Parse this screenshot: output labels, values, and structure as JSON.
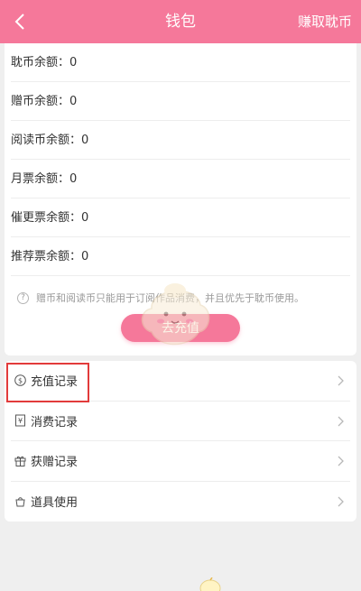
{
  "header": {
    "back_icon": "chevron-left-icon",
    "title": "钱包",
    "action": "赚取耽币"
  },
  "balances": [
    {
      "label": "耽币余额：",
      "value": "0"
    },
    {
      "label": "赠币余额：",
      "value": "0"
    },
    {
      "label": "阅读币余额：",
      "value": "0"
    },
    {
      "label": "月票余额：",
      "value": "0"
    },
    {
      "label": "催更票余额：",
      "value": "0"
    },
    {
      "label": "推荐票余额：",
      "value": "0"
    }
  ],
  "note": {
    "icon": "question-circle-icon",
    "text": "赠币和阅读币只能用于订阅作品消费，并且优先于耽币使用。"
  },
  "recharge_button": "去充值",
  "menu": [
    {
      "label": "充值记录",
      "icon": "dollar-circle-icon"
    },
    {
      "label": "消费记录",
      "icon": "receipt-icon"
    },
    {
      "label": "获赠记录",
      "icon": "gift-icon"
    },
    {
      "label": "道具使用",
      "icon": "bag-icon"
    }
  ],
  "colors": {
    "brand_pink": "#f5789a",
    "highlight_red": "#e23b3b",
    "background": "#efefef"
  }
}
